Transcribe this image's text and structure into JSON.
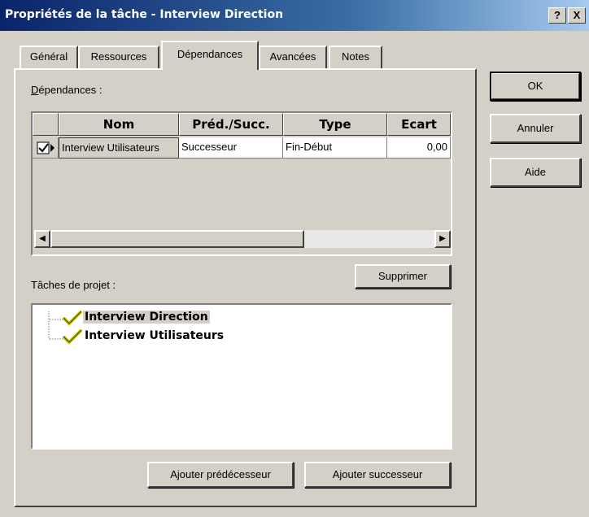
{
  "window": {
    "title": "Propriétés de la tâche - Interview Direction",
    "help_btn": "?",
    "close_btn": "X"
  },
  "tabs": [
    {
      "label": "Général",
      "active": false
    },
    {
      "label": "Ressources",
      "active": false
    },
    {
      "label": "Dépendances",
      "active": true
    },
    {
      "label": "Avancées",
      "active": false
    },
    {
      "label": "Notes",
      "active": false
    }
  ],
  "dependencies": {
    "label": "Dépendances :",
    "columns": [
      "Nom",
      "Préd./Succ.",
      "Type",
      "Ecart"
    ],
    "rows": [
      {
        "name": "Interview Utilisateurs",
        "pred_succ": "Successeur",
        "type": "Fin-Début",
        "ecart": "0,00"
      }
    ]
  },
  "project_tasks": {
    "label": "Tâches de projet :",
    "items": [
      {
        "label": "Interview Direction",
        "selected": true
      },
      {
        "label": "Interview Utilisateurs",
        "selected": false
      }
    ]
  },
  "buttons": {
    "ok": "OK",
    "cancel": "Annuler",
    "help": "Aide",
    "delete": "Supprimer",
    "add_predecessor": "Ajouter prédécesseur",
    "add_successor": "Ajouter successeur"
  },
  "colors": {
    "title_bar": "#0a246a",
    "face": "#d4d0c8",
    "check": "#c8c800"
  }
}
